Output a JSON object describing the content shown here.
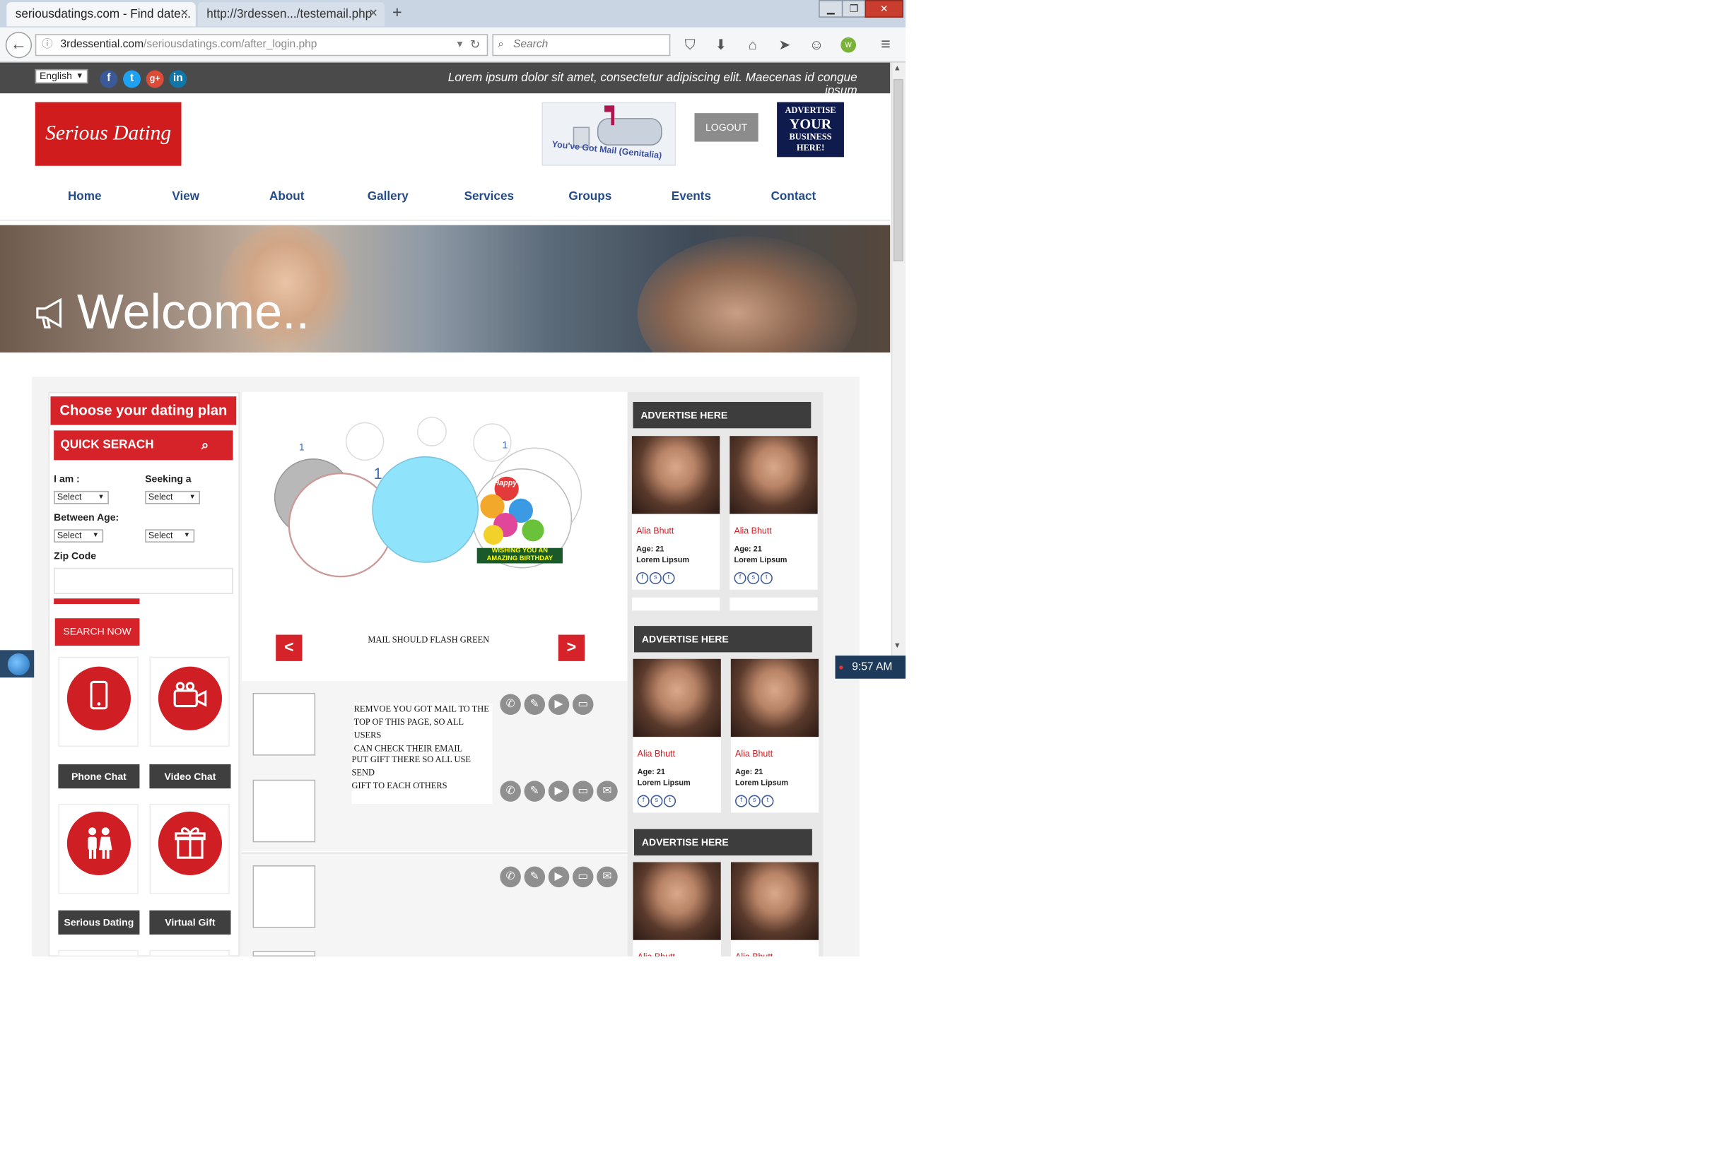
{
  "browser": {
    "tabs": [
      {
        "label": "seriousdatings.com - Find date..."
      },
      {
        "label": "http://3rdessen.../testemail.php"
      }
    ],
    "new_tab": "+",
    "url_domain": "3rdessential.com",
    "url_path": "/seriousdatings.com/after_login.php",
    "search_placeholder": "Search"
  },
  "topbar": {
    "language": "English",
    "social": [
      "f",
      "t",
      "g+",
      "in"
    ],
    "tagline": "Lorem ipsum dolor sit amet, consectetur adipiscing elit. Maecenas id congue ipsum"
  },
  "header": {
    "logo_text": "Serious Dating",
    "mail_banner": "You've Got Mail (Genitalia)",
    "logout": "LOGOUT",
    "advertise_banner": [
      "ADVERTISE",
      "YOUR",
      "BUSINESS",
      "HERE!"
    ]
  },
  "nav": [
    "Home",
    "View",
    "About",
    "Gallery",
    "Services",
    "Groups",
    "Events",
    "Contact"
  ],
  "hero": {
    "welcome": "Welcome.."
  },
  "sidebar": {
    "plan_title": "Choose your dating plan",
    "quick_search": "QUICK SERACH",
    "i_am": "I am :",
    "seeking": "Seeking a",
    "between_age": "Between Age:",
    "select": "Select",
    "zip_code": "Zip Code",
    "search_now": "SEARCH NOW",
    "features": [
      {
        "label": "Phone Chat",
        "icon": "phone-icon"
      },
      {
        "label": "Video Chat",
        "icon": "video-camera-icon"
      },
      {
        "label": "Serious Dating",
        "icon": "couple-icon"
      },
      {
        "label": "Virtual Gift",
        "icon": "gift-icon"
      }
    ]
  },
  "slider": {
    "prev": "<",
    "next": ">",
    "message": "MAIL SHOULD FLASH GREEN",
    "birthday_caption": "WISHING YOU AN AMAZING BIRTHDAY",
    "birthday_top": "Happy Birthday"
  },
  "notes": {
    "note1": [
      "REMVOE YOU GOT MAIL TO THE",
      "TOP OF THIS PAGE, SO ALL USERS",
      "CAN CHECK THEIR EMAIL"
    ],
    "note2": [
      "PUT GIFT THERE SO ALL USE",
      "SEND",
      "GIFT TO EACH OTHERS"
    ]
  },
  "ads": {
    "header": "ADVERTISE HERE",
    "profile_name": "Alia Bhutt",
    "profile_age": "Age: 21",
    "profile_sub": "Lorem Lipsum"
  },
  "taskbar": {
    "time": "9:57 AM"
  },
  "colors": {
    "brand_red": "#d62229",
    "nav_blue": "#234a8a",
    "dark_gray": "#3f3f3f"
  }
}
